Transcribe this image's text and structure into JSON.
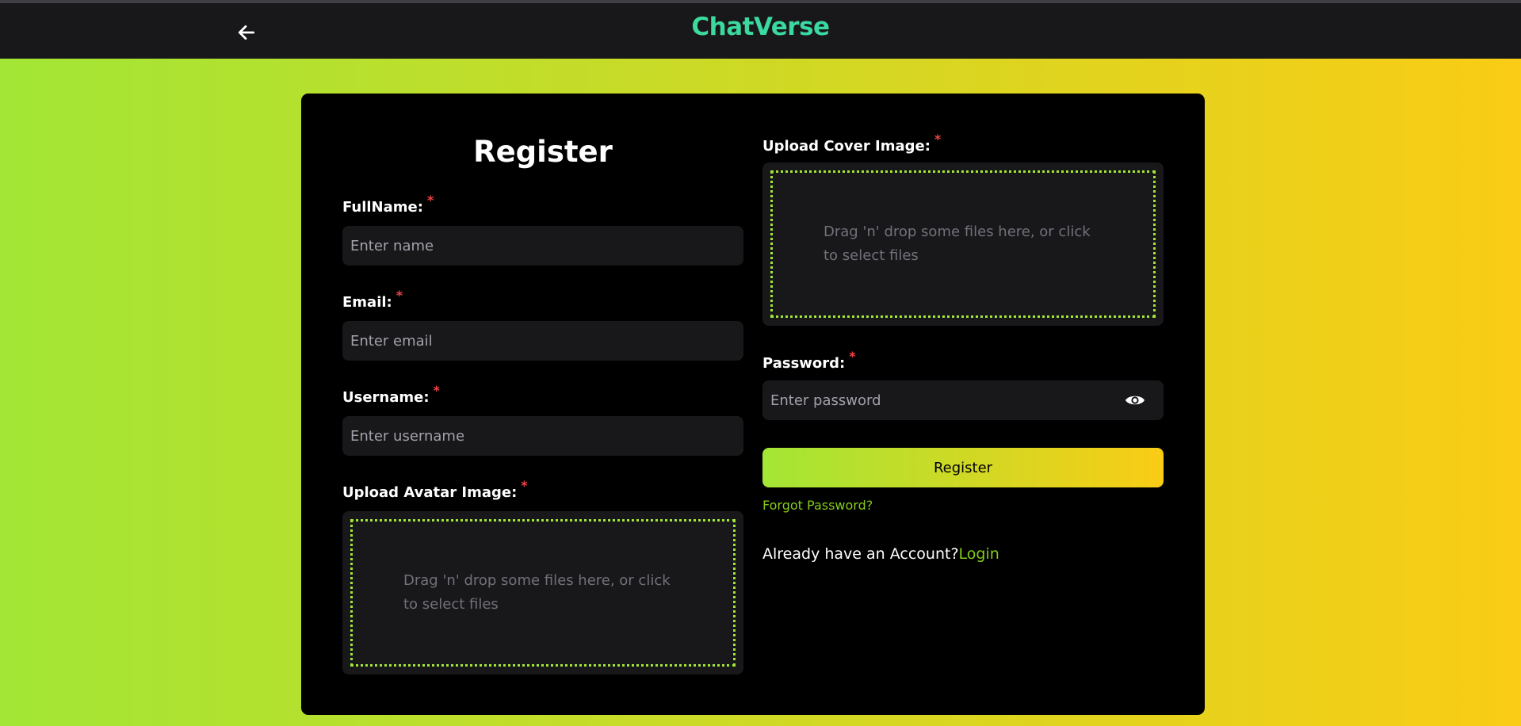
{
  "header": {
    "back_icon": "arrow-left-icon",
    "logo": "ChatVerse"
  },
  "form": {
    "title": "Register",
    "required_mark": "*",
    "fullname": {
      "label": "FullName:",
      "placeholder": "Enter name"
    },
    "email": {
      "label": "Email:",
      "placeholder": "Enter email"
    },
    "username": {
      "label": "Username:",
      "placeholder": "Enter username"
    },
    "avatar": {
      "label": "Upload Avatar Image:",
      "dropzone_text": "Drag 'n' drop some files here, or click to select files"
    },
    "cover": {
      "label": "Upload Cover Image:",
      "dropzone_text": "Drag 'n' drop some files here, or click to select files"
    },
    "password": {
      "label": "Password:",
      "placeholder": "Enter password",
      "toggle_icon": "eye-icon"
    },
    "submit_label": "Register",
    "forgot_label": "Forgot Password?",
    "already_text": "Already have an Account?",
    "login_label": "Login"
  },
  "colors": {
    "gradient_start": "#a3e635",
    "gradient_end": "#facc15",
    "required": "#ef4444",
    "link": "#84cc16",
    "logo_start": "#4ade80",
    "logo_end": "#2dd4bf"
  }
}
